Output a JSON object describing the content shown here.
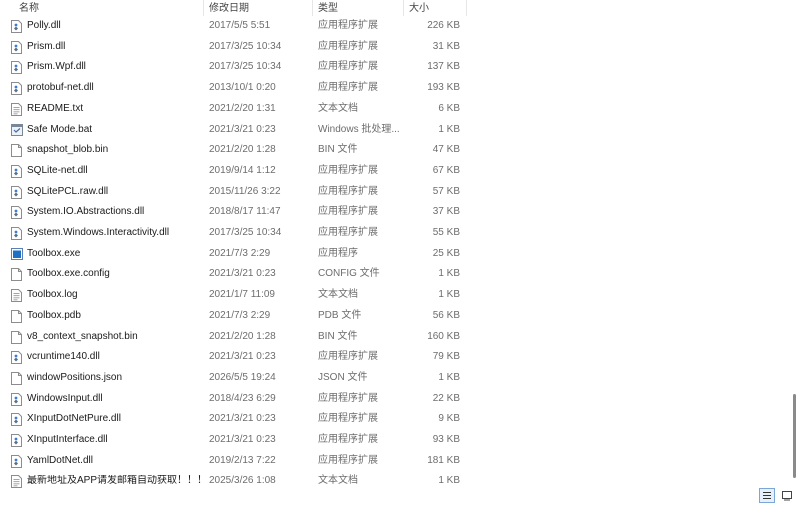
{
  "columns": {
    "name": "名称",
    "modified": "修改日期",
    "type": "类型",
    "size": "大小"
  },
  "files": [
    {
      "name": "Polly.dll",
      "modified": "2017/5/5 5:51",
      "type": "应用程序扩展",
      "size": "226 KB",
      "icon": "dll-icon"
    },
    {
      "name": "Prism.dll",
      "modified": "2017/3/25 10:34",
      "type": "应用程序扩展",
      "size": "31 KB",
      "icon": "dll-icon"
    },
    {
      "name": "Prism.Wpf.dll",
      "modified": "2017/3/25 10:34",
      "type": "应用程序扩展",
      "size": "137 KB",
      "icon": "dll-icon"
    },
    {
      "name": "protobuf-net.dll",
      "modified": "2013/10/1 0:20",
      "type": "应用程序扩展",
      "size": "193 KB",
      "icon": "dll-icon"
    },
    {
      "name": "README.txt",
      "modified": "2021/2/20 1:31",
      "type": "文本文档",
      "size": "6 KB",
      "icon": "text-file-icon"
    },
    {
      "name": "Safe Mode.bat",
      "modified": "2021/3/21 0:23",
      "type": "Windows 批处理...",
      "size": "1 KB",
      "icon": "batch-file-icon"
    },
    {
      "name": "snapshot_blob.bin",
      "modified": "2021/2/20 1:28",
      "type": "BIN 文件",
      "size": "47 KB",
      "icon": "blank-file-icon"
    },
    {
      "name": "SQLite-net.dll",
      "modified": "2019/9/14 1:12",
      "type": "应用程序扩展",
      "size": "67 KB",
      "icon": "dll-icon"
    },
    {
      "name": "SQLitePCL.raw.dll",
      "modified": "2015/11/26 3:22",
      "type": "应用程序扩展",
      "size": "57 KB",
      "icon": "dll-icon"
    },
    {
      "name": "System.IO.Abstractions.dll",
      "modified": "2018/8/17 11:47",
      "type": "应用程序扩展",
      "size": "37 KB",
      "icon": "dll-icon"
    },
    {
      "name": "System.Windows.Interactivity.dll",
      "modified": "2017/3/25 10:34",
      "type": "应用程序扩展",
      "size": "55 KB",
      "icon": "dll-icon"
    },
    {
      "name": "Toolbox.exe",
      "modified": "2021/7/3 2:29",
      "type": "应用程序",
      "size": "25 KB",
      "icon": "exe-icon"
    },
    {
      "name": "Toolbox.exe.config",
      "modified": "2021/3/21 0:23",
      "type": "CONFIG 文件",
      "size": "1 KB",
      "icon": "blank-file-icon"
    },
    {
      "name": "Toolbox.log",
      "modified": "2021/1/7 11:09",
      "type": "文本文档",
      "size": "1 KB",
      "icon": "text-file-icon"
    },
    {
      "name": "Toolbox.pdb",
      "modified": "2021/7/3 2:29",
      "type": "PDB 文件",
      "size": "56 KB",
      "icon": "blank-file-icon"
    },
    {
      "name": "v8_context_snapshot.bin",
      "modified": "2021/2/20 1:28",
      "type": "BIN 文件",
      "size": "160 KB",
      "icon": "blank-file-icon"
    },
    {
      "name": "vcruntime140.dll",
      "modified": "2021/3/21 0:23",
      "type": "应用程序扩展",
      "size": "79 KB",
      "icon": "dll-icon"
    },
    {
      "name": "windowPositions.json",
      "modified": "2026/5/5 19:24",
      "type": "JSON 文件",
      "size": "1 KB",
      "icon": "blank-file-icon"
    },
    {
      "name": "WindowsInput.dll",
      "modified": "2018/4/23 6:29",
      "type": "应用程序扩展",
      "size": "22 KB",
      "icon": "dll-icon"
    },
    {
      "name": "XInputDotNetPure.dll",
      "modified": "2021/3/21 0:23",
      "type": "应用程序扩展",
      "size": "9 KB",
      "icon": "dll-icon"
    },
    {
      "name": "XInputInterface.dll",
      "modified": "2021/3/21 0:23",
      "type": "应用程序扩展",
      "size": "93 KB",
      "icon": "dll-icon"
    },
    {
      "name": "YamlDotNet.dll",
      "modified": "2019/2/13 7:22",
      "type": "应用程序扩展",
      "size": "181 KB",
      "icon": "dll-icon"
    },
    {
      "name": "最新地址及APP请发邮箱自动获取！！！.t...",
      "modified": "2025/3/26 1:08",
      "type": "文本文档",
      "size": "1 KB",
      "icon": "text-file-icon"
    }
  ],
  "colors": {
    "accent": "#1f6fc5",
    "row_text": "#1a1a1a",
    "meta_text": "#6d6d6d",
    "header_text": "#444444"
  }
}
